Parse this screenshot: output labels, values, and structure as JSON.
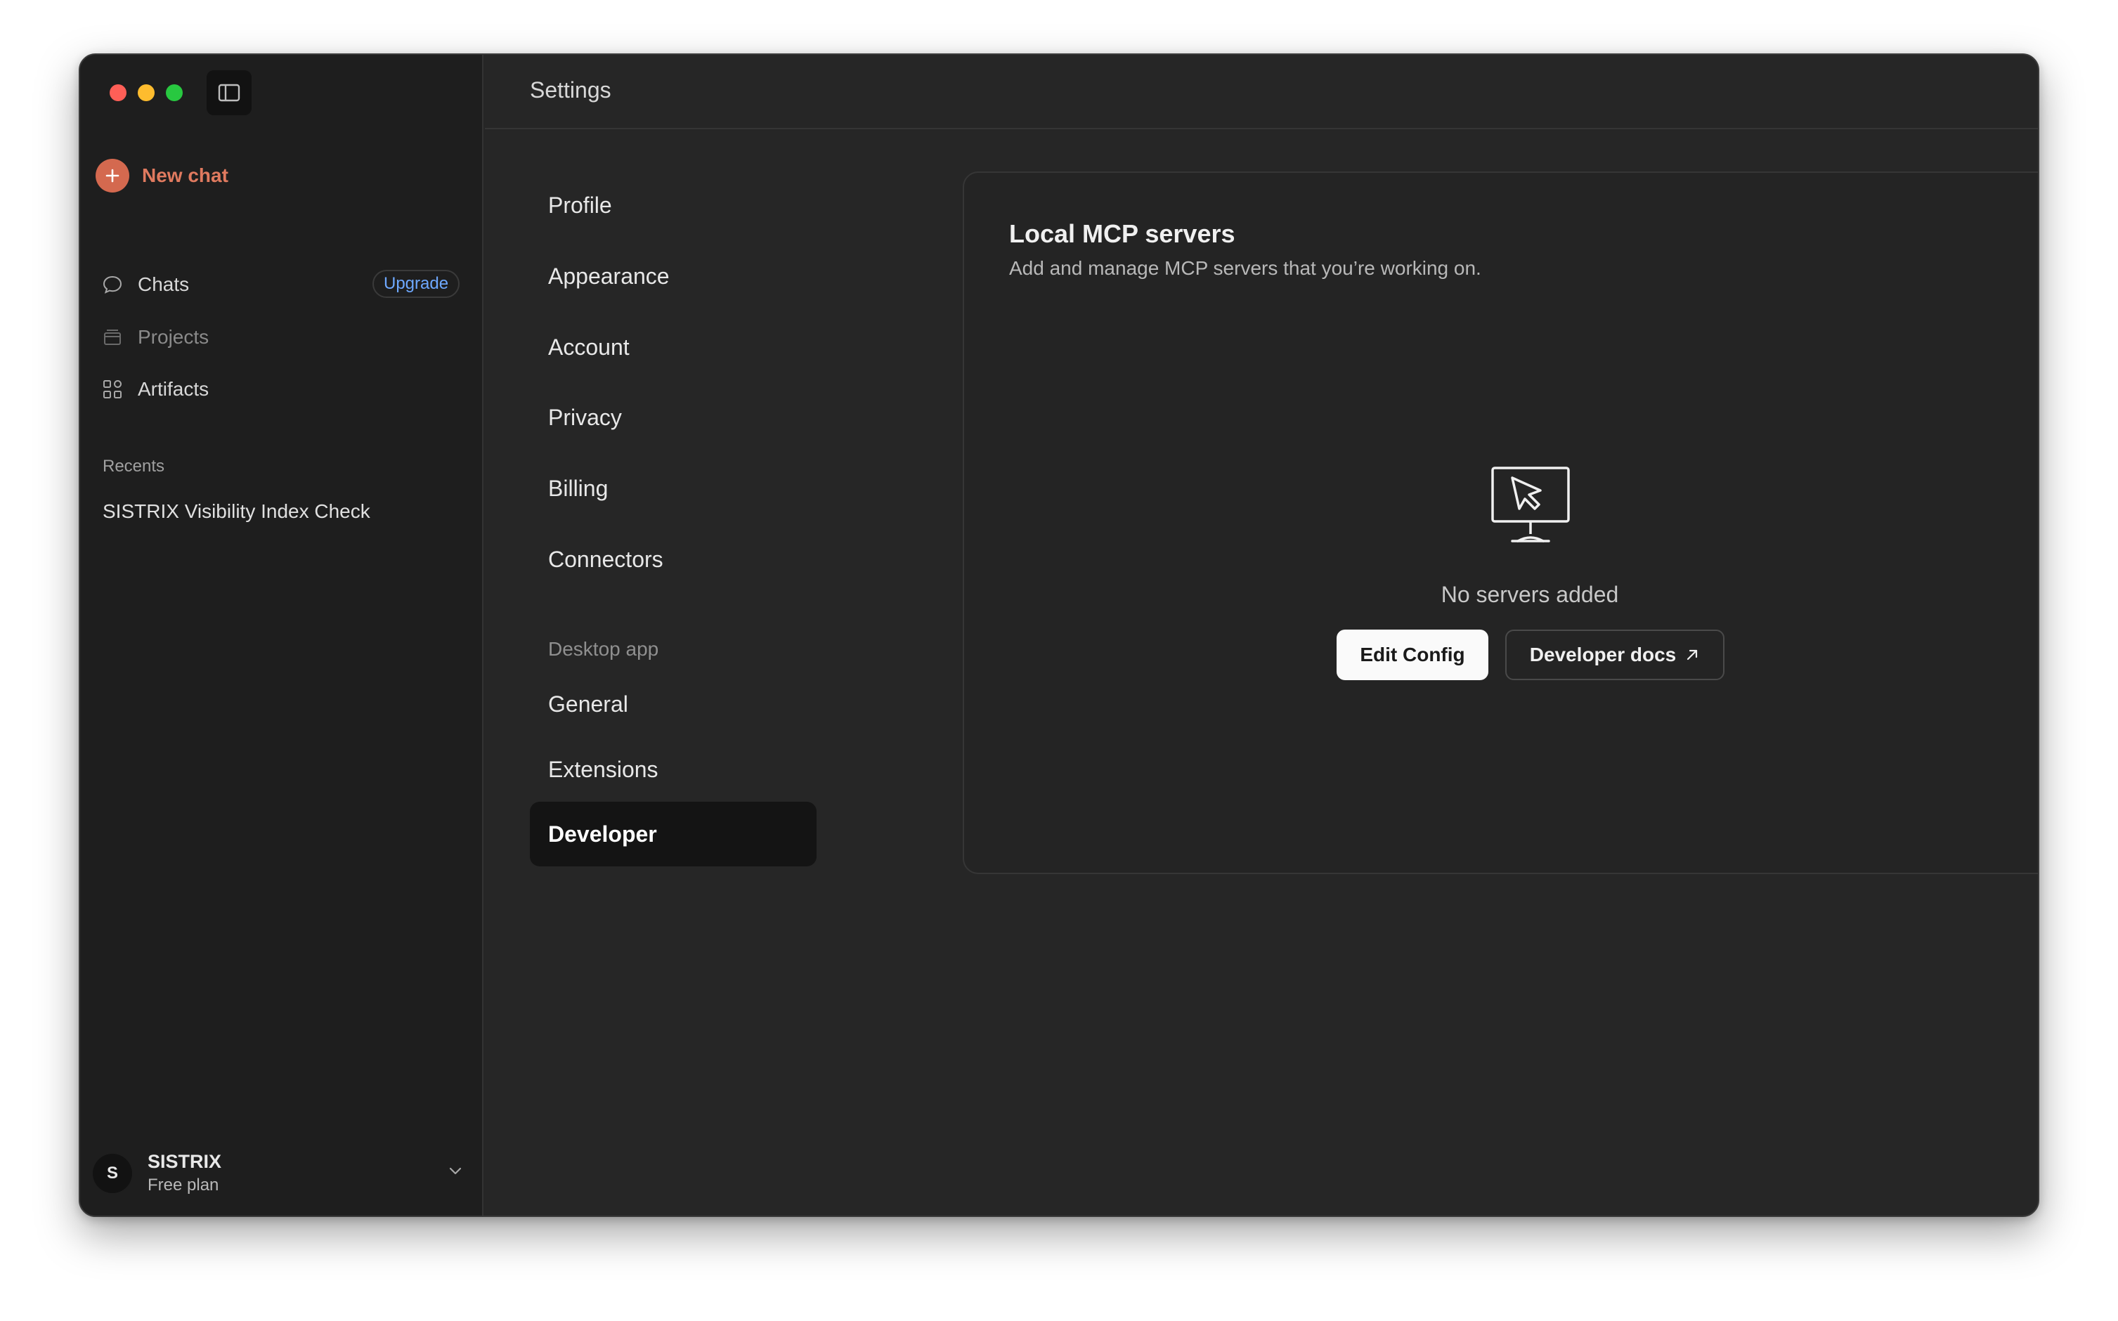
{
  "sidebar": {
    "new_chat": "New chat",
    "items": [
      {
        "label": "Chats",
        "icon": "chat-bubble-icon"
      },
      {
        "label": "Projects",
        "icon": "folder-icon",
        "badge": "Upgrade"
      },
      {
        "label": "Artifacts",
        "icon": "grid-icon"
      }
    ],
    "recents_title": "Recents",
    "recents": [
      "SISTRIX Visibility Index Check"
    ],
    "user": {
      "initial": "S",
      "name": "SISTRIX",
      "plan": "Free plan"
    }
  },
  "header": {
    "title": "Settings"
  },
  "settings_nav": {
    "items": [
      "Profile",
      "Appearance",
      "Account",
      "Privacy",
      "Billing",
      "Connectors"
    ],
    "section_title": "Desktop app",
    "desktop_items": [
      "General",
      "Extensions",
      "Developer"
    ],
    "active": "Developer"
  },
  "panel": {
    "title": "Local MCP servers",
    "subtitle": "Add and manage MCP servers that you’re working on.",
    "empty_text": "No servers added",
    "edit_config": "Edit Config",
    "developer_docs": "Developer docs"
  },
  "colors": {
    "accent": "#d4694f",
    "window_bg": "#262626",
    "sidebar_bg": "#1e1e1e",
    "link_blue": "#6ea8ff"
  }
}
